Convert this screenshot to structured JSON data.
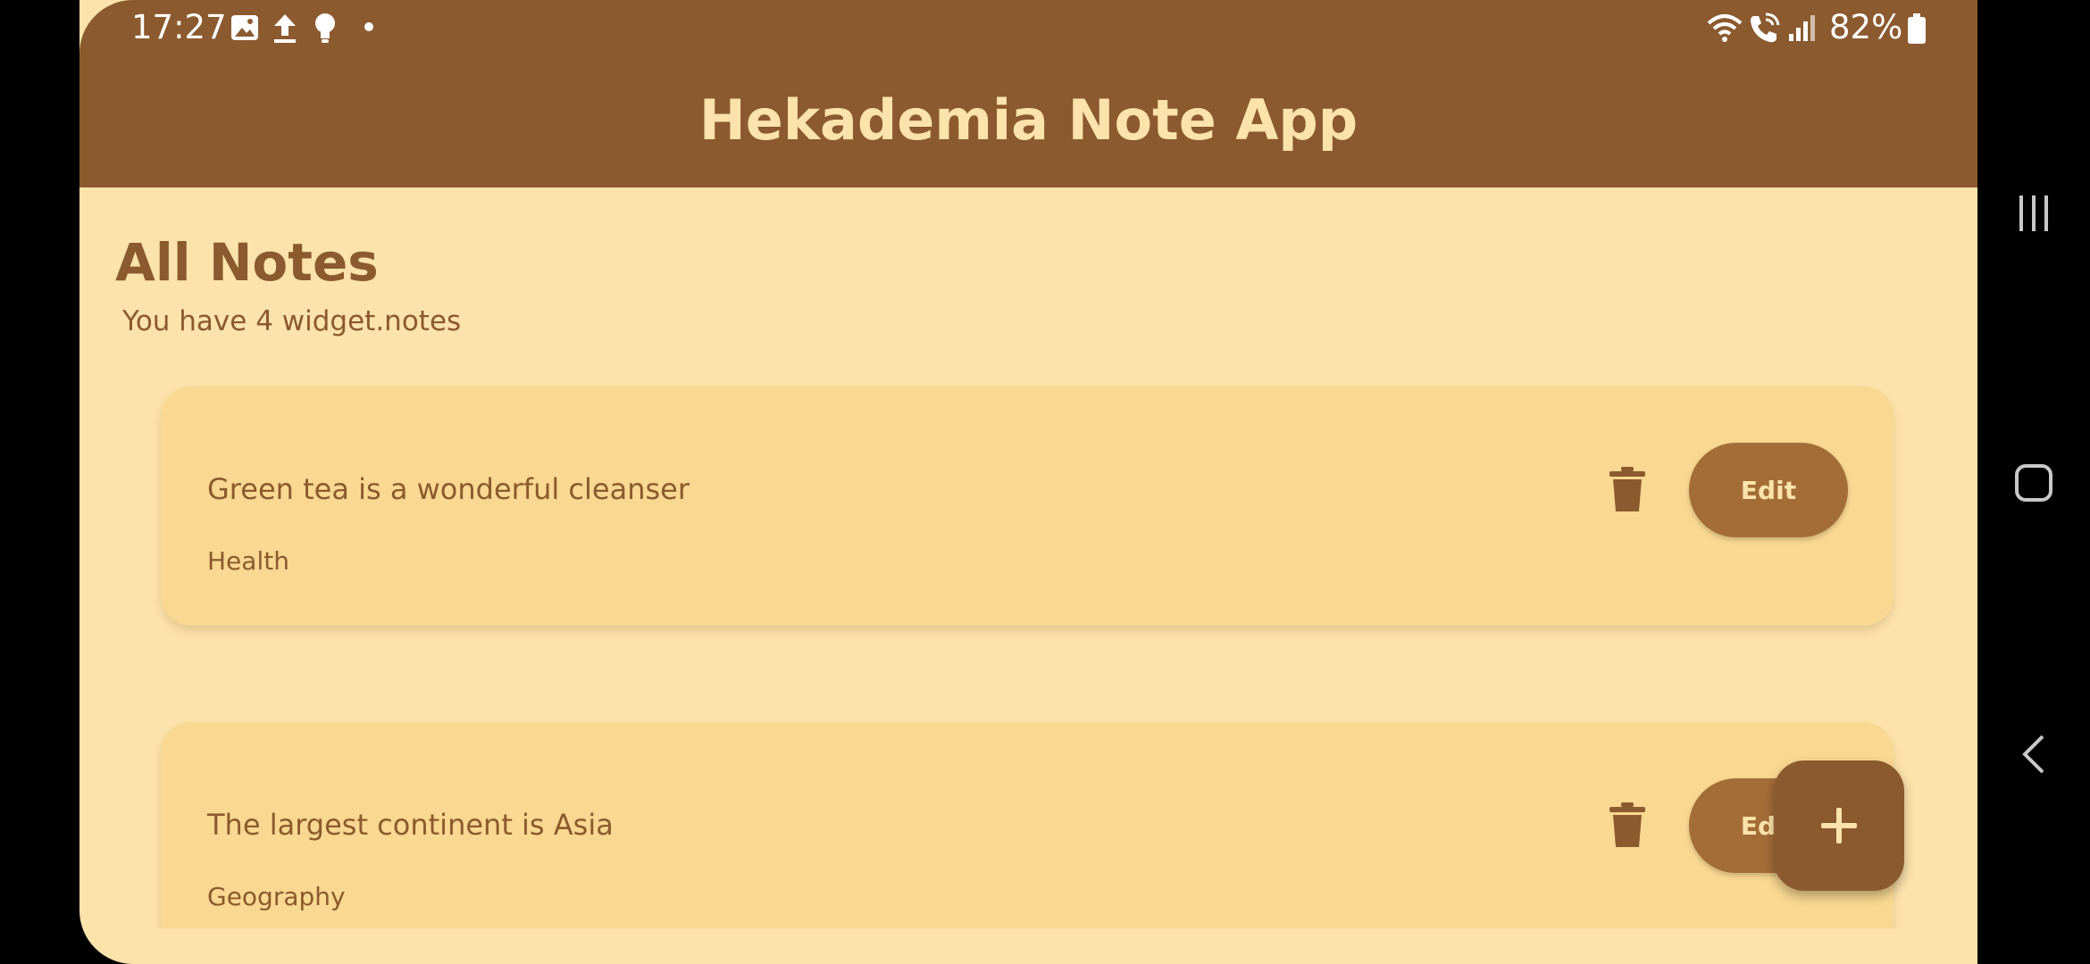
{
  "status_bar": {
    "time": "17:27",
    "battery_text": "82%",
    "icons": [
      "image-icon",
      "upload-icon",
      "lightbulb-icon",
      "dot-icon",
      "wifi-icon",
      "wifi-call-icon",
      "signal-icon",
      "battery-icon"
    ]
  },
  "app": {
    "title": "Hekademia Note App"
  },
  "main": {
    "section_title": "All Notes",
    "note_count_text": "You have 4 widget.notes"
  },
  "notes": [
    {
      "title": "Green tea is a wonderful cleanser",
      "category": "Health",
      "edit_label": "Edit"
    },
    {
      "title": "The largest continent is Asia",
      "category": "Geography",
      "edit_label": "Edit"
    }
  ],
  "colors": {
    "appbar": "#8B5A2E",
    "background": "#FCE3AC",
    "card": "#F9D891",
    "edit_button": "#A46D38",
    "text": "#8B5A2E"
  }
}
